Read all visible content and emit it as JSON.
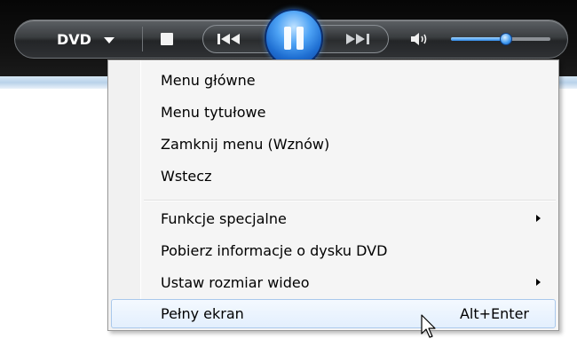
{
  "player": {
    "dvd_label": "DVD",
    "volume_level": 0.55,
    "icons": {
      "dvd_menu": "chevron-down-icon",
      "stop": "stop-icon",
      "previous": "skip-previous-icon",
      "play_pause": "pause-icon",
      "next": "skip-next-icon",
      "volume": "speaker-icon"
    },
    "colors": {
      "accent": "#2f8ae8",
      "bar": "#2a2c2e"
    }
  },
  "menu": {
    "group1": [
      {
        "label": "Menu główne"
      },
      {
        "label": "Menu tytułowe"
      },
      {
        "label": "Zamknij menu (Wznów)"
      },
      {
        "label": "Wstecz"
      }
    ],
    "group2": [
      {
        "label": "Funkcje specjalne",
        "submenu": true
      },
      {
        "label": "Pobierz informacje o dysku DVD"
      },
      {
        "label": "Ustaw rozmiar wideo",
        "submenu": true
      },
      {
        "label": "Pełny ekran",
        "shortcut": "Alt+Enter",
        "highlighted": true
      }
    ],
    "colors": {
      "highlight_border": "#a9c8ec",
      "highlight_fill": "#e3effd"
    }
  }
}
